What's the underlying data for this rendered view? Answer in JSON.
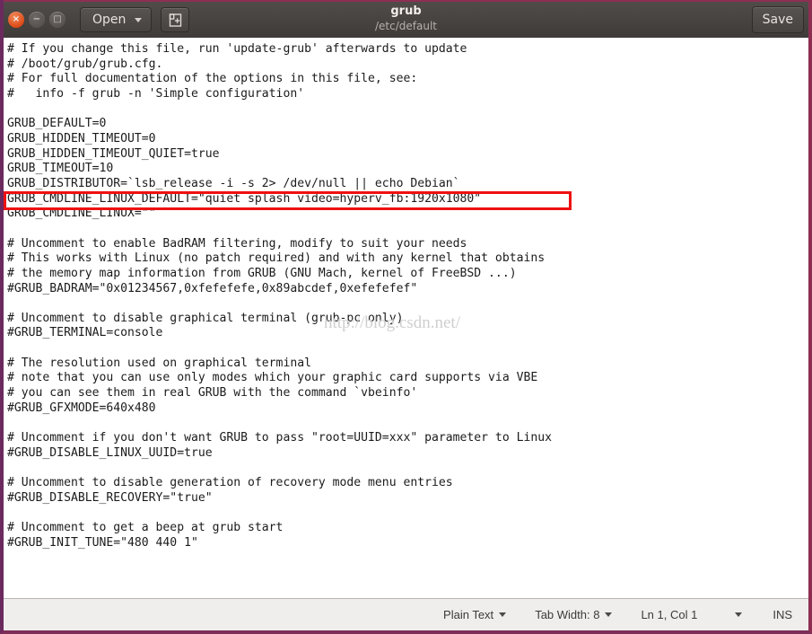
{
  "window": {
    "controls": {
      "close_label": "×",
      "minimize_label": "−",
      "maximize_label": "□"
    }
  },
  "titlebar": {
    "open_label": "Open",
    "new_tab_icon": "new-tab-icon",
    "title": "grub",
    "subtitle": "/etc/default",
    "save_label": "Save"
  },
  "editor": {
    "content": "# If you change this file, run 'update-grub' afterwards to update\n# /boot/grub/grub.cfg.\n# For full documentation of the options in this file, see:\n#   info -f grub -n 'Simple configuration'\n\nGRUB_DEFAULT=0\nGRUB_HIDDEN_TIMEOUT=0\nGRUB_HIDDEN_TIMEOUT_QUIET=true\nGRUB_TIMEOUT=10\nGRUB_DISTRIBUTOR=`lsb_release -i -s 2> /dev/null || echo Debian`\nGRUB_CMDLINE_LINUX_DEFAULT=\"quiet splash video=hyperv_fb:1920x1080\"\nGRUB_CMDLINE_LINUX=\"\"\n\n# Uncomment to enable BadRAM filtering, modify to suit your needs\n# This works with Linux (no patch required) and with any kernel that obtains\n# the memory map information from GRUB (GNU Mach, kernel of FreeBSD ...)\n#GRUB_BADRAM=\"0x01234567,0xfefefefe,0x89abcdef,0xefefefef\"\n\n# Uncomment to disable graphical terminal (grub-pc only)\n#GRUB_TERMINAL=console\n\n# The resolution used on graphical terminal\n# note that you can use only modes which your graphic card supports via VBE\n# you can see them in real GRUB with the command `vbeinfo'\n#GRUB_GFXMODE=640x480\n\n# Uncomment if you don't want GRUB to pass \"root=UUID=xxx\" parameter to Linux\n#GRUB_DISABLE_LINUX_UUID=true\n\n# Uncomment to disable generation of recovery mode menu entries\n#GRUB_DISABLE_RECOVERY=\"true\"\n\n# Uncomment to get a beep at grub start\n#GRUB_INIT_TUNE=\"480 440 1\"",
    "highlighted_line": "GRUB_CMDLINE_LINUX_DEFAULT=\"quiet splash video=hyperv_fb:1920x1080\"",
    "highlight_color": "#ee1111",
    "watermark": "http://blog.csdn.net/"
  },
  "statusbar": {
    "language": "Plain Text",
    "tab_width": "Tab Width: 8",
    "position": "Ln 1, Col 1",
    "insert_mode": "INS"
  },
  "colors": {
    "titlebar_bg": "#453f3c",
    "window_border": "#7d2d58",
    "accent_close": "#dd4814",
    "statusbar_bg": "#efeeec"
  }
}
